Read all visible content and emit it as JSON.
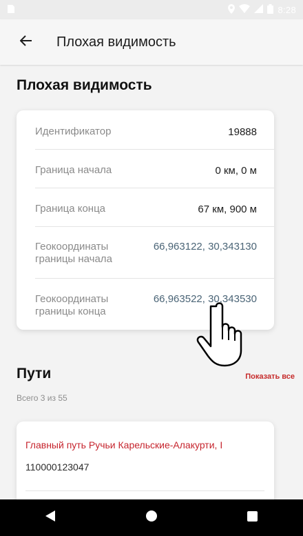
{
  "status_bar": {
    "time": "8:28",
    "icons": [
      "sim-card-icon",
      "location-icon",
      "wifi-icon",
      "signal-icon",
      "battery-icon"
    ]
  },
  "app_bar": {
    "title": "Плохая видимость",
    "back_icon": "arrow-left-icon"
  },
  "page_title": "Плохая видимость",
  "details": [
    {
      "label": "Идентификатор",
      "value": "19888",
      "is_link": false
    },
    {
      "label": "Граница начала",
      "value": "0 км, 0 м",
      "is_link": false
    },
    {
      "label": "Граница конца",
      "value": "67 км, 900 м",
      "is_link": false
    },
    {
      "label_line1": "Геокоординаты",
      "label_line2": "границы начала",
      "value": "66,963122, 30,343130",
      "is_link": true
    },
    {
      "label_line1": "Геокоординаты",
      "label_line2": "границы конца",
      "value": "66,963522, 30,343530",
      "is_link": true
    }
  ],
  "paths": {
    "title": "Пути",
    "show_all": "Показать все",
    "count": "Всего 3 из 55",
    "items": [
      {
        "name": "Главный путь Ручьи Карельские-Алакурти, I",
        "code": "110000123047"
      }
    ]
  },
  "nav_bar": {
    "icons": [
      "back-triangle-icon",
      "home-circle-icon",
      "recents-square-icon"
    ]
  },
  "colors": {
    "link": "#4a6476",
    "accent_red": "#c62b2b",
    "nav_bar": "#000000"
  }
}
